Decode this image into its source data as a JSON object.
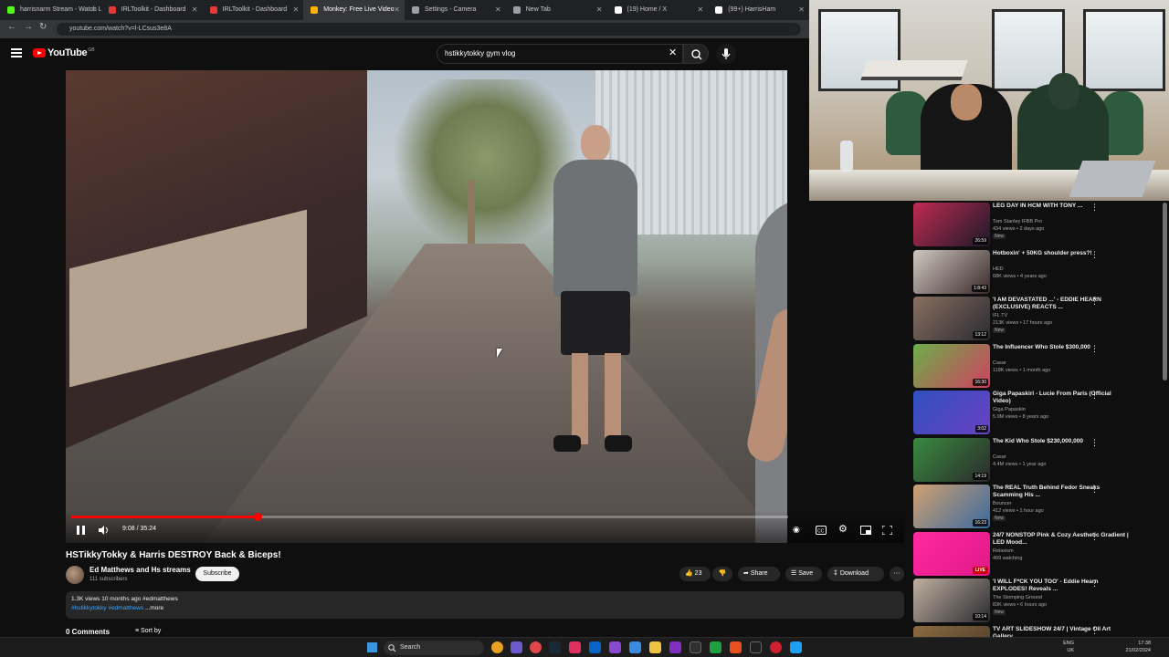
{
  "browser": {
    "tabs": [
      {
        "label": "harrisnarm Stream - Watch Li",
        "color": "#53fc18"
      },
      {
        "label": "IRLToolkit - Dashboard",
        "color": "#e53935"
      },
      {
        "label": "IRLToolkit - Dashboard",
        "color": "#e53935"
      },
      {
        "label": "Monkey: Free Live Video",
        "color": "#ffb300"
      },
      {
        "label": "Settings - Camera",
        "color": "#9aa0a6"
      },
      {
        "label": "New Tab",
        "color": "#9aa0a6"
      },
      {
        "label": "(19) Home / X",
        "color": "#ffffff"
      },
      {
        "label": "(99+) HarrisHam",
        "color": "#ffffff"
      }
    ],
    "url": "youtube.com/watch?v=l-LCsus3e8A"
  },
  "masthead": {
    "logo": "YouTube",
    "country": "GB",
    "search_value": "hstikkytokky gym vlog"
  },
  "player": {
    "time": "9:08 / 35:24",
    "progress": 0.26
  },
  "video": {
    "title": "HSTikkyTokky & Harris DESTROY Back & Biceps!",
    "channel": "Ed Matthews and Hs streams",
    "subscribers": "111 subscribers",
    "subscribe_label": "Subscribe",
    "likes": "23",
    "share_label": "Share",
    "save_label": "Save",
    "download_label": "Download",
    "views_line": "1.3K views  10 months ago  #edmatthews",
    "hashtags": "#hstikkytokky #edmatthews",
    "more_label": "...more",
    "comments_label": "0 Comments",
    "sort_label": "Sort by"
  },
  "recommendations": [
    {
      "title": "LEG DAY IN HCM WITH TONY ...",
      "channel": "Tom Stanley IFBB Pro",
      "meta": "434 views • 2 days ago",
      "badge": "New",
      "duration": "26:59",
      "colors": [
        "#c02a50",
        "#1a1a2a"
      ]
    },
    {
      "title": "Hotboxin' + 50KG shoulder press?!",
      "channel": "HED",
      "meta": "68K views • 4 years ago",
      "badge": "",
      "duration": "1:8:43",
      "colors": [
        "#d0c8c0",
        "#3a2a2a"
      ]
    },
    {
      "title": "'I AM DEVASTATED ...' - EDDIE HEARN (EXCLUSIVE) REACTS ...",
      "channel": "IFL TV",
      "meta": "213K views • 17 hours ago",
      "badge": "New",
      "duration": "13:12",
      "colors": [
        "#8a7060",
        "#2a2a32"
      ]
    },
    {
      "title": "The Influencer Who Stole $300,000",
      "channel": "Casar",
      "meta": "118K views • 1 month ago",
      "badge": "",
      "duration": "16:30",
      "colors": [
        "#6cae4a",
        "#d04060"
      ]
    },
    {
      "title": "Giga Papaskiri - Lucie From Paris (Official Video)",
      "channel": "Giga Papaskiri",
      "meta": "5.9M views • 8 years ago",
      "badge": "",
      "duration": "3:02",
      "colors": [
        "#3050c0",
        "#6a40c0"
      ]
    },
    {
      "title": "The Kid Who Stole $230,000,000",
      "channel": "Casar",
      "meta": "4.4M views • 1 year ago",
      "badge": "",
      "duration": "14:19",
      "colors": [
        "#3a8a40",
        "#2a2a2a"
      ]
    },
    {
      "title": "The REAL Truth Behind Fedor Sneaks Scamming His ...",
      "channel": "Bouncer",
      "meta": "412 views • 1 hour ago",
      "badge": "New",
      "duration": "16:23",
      "colors": [
        "#d0a070",
        "#3a6aa0"
      ]
    },
    {
      "title": "24/7 NONSTOP Pink & Cozy Aesthetic Gradient | LED Mood...",
      "channel": "Relaxism",
      "meta": "499 watching",
      "badge": "",
      "duration": "LIVE",
      "colors": [
        "#ff2aa0",
        "#e01888"
      ]
    },
    {
      "title": "'I WILL F*CK YOU TOO' - Eddie Hearn EXPLODES! Reveals ...",
      "channel": "The Stomping Ground",
      "meta": "83K views • 6 hours ago",
      "badge": "New",
      "duration": "10:14",
      "colors": [
        "#c0b0a0",
        "#2a2a30"
      ]
    },
    {
      "title": "TV ART SLIDESHOW 24/7 | Vintage Oil Art Gallery",
      "channel": "",
      "meta": "",
      "badge": "",
      "duration": "",
      "colors": [
        "#8a6a40",
        "#4a3a2a"
      ]
    }
  ],
  "taskbar": {
    "search_label": "Search",
    "lang": "ENG",
    "region": "UK",
    "time": "17:38",
    "date": "21/02/2024"
  }
}
